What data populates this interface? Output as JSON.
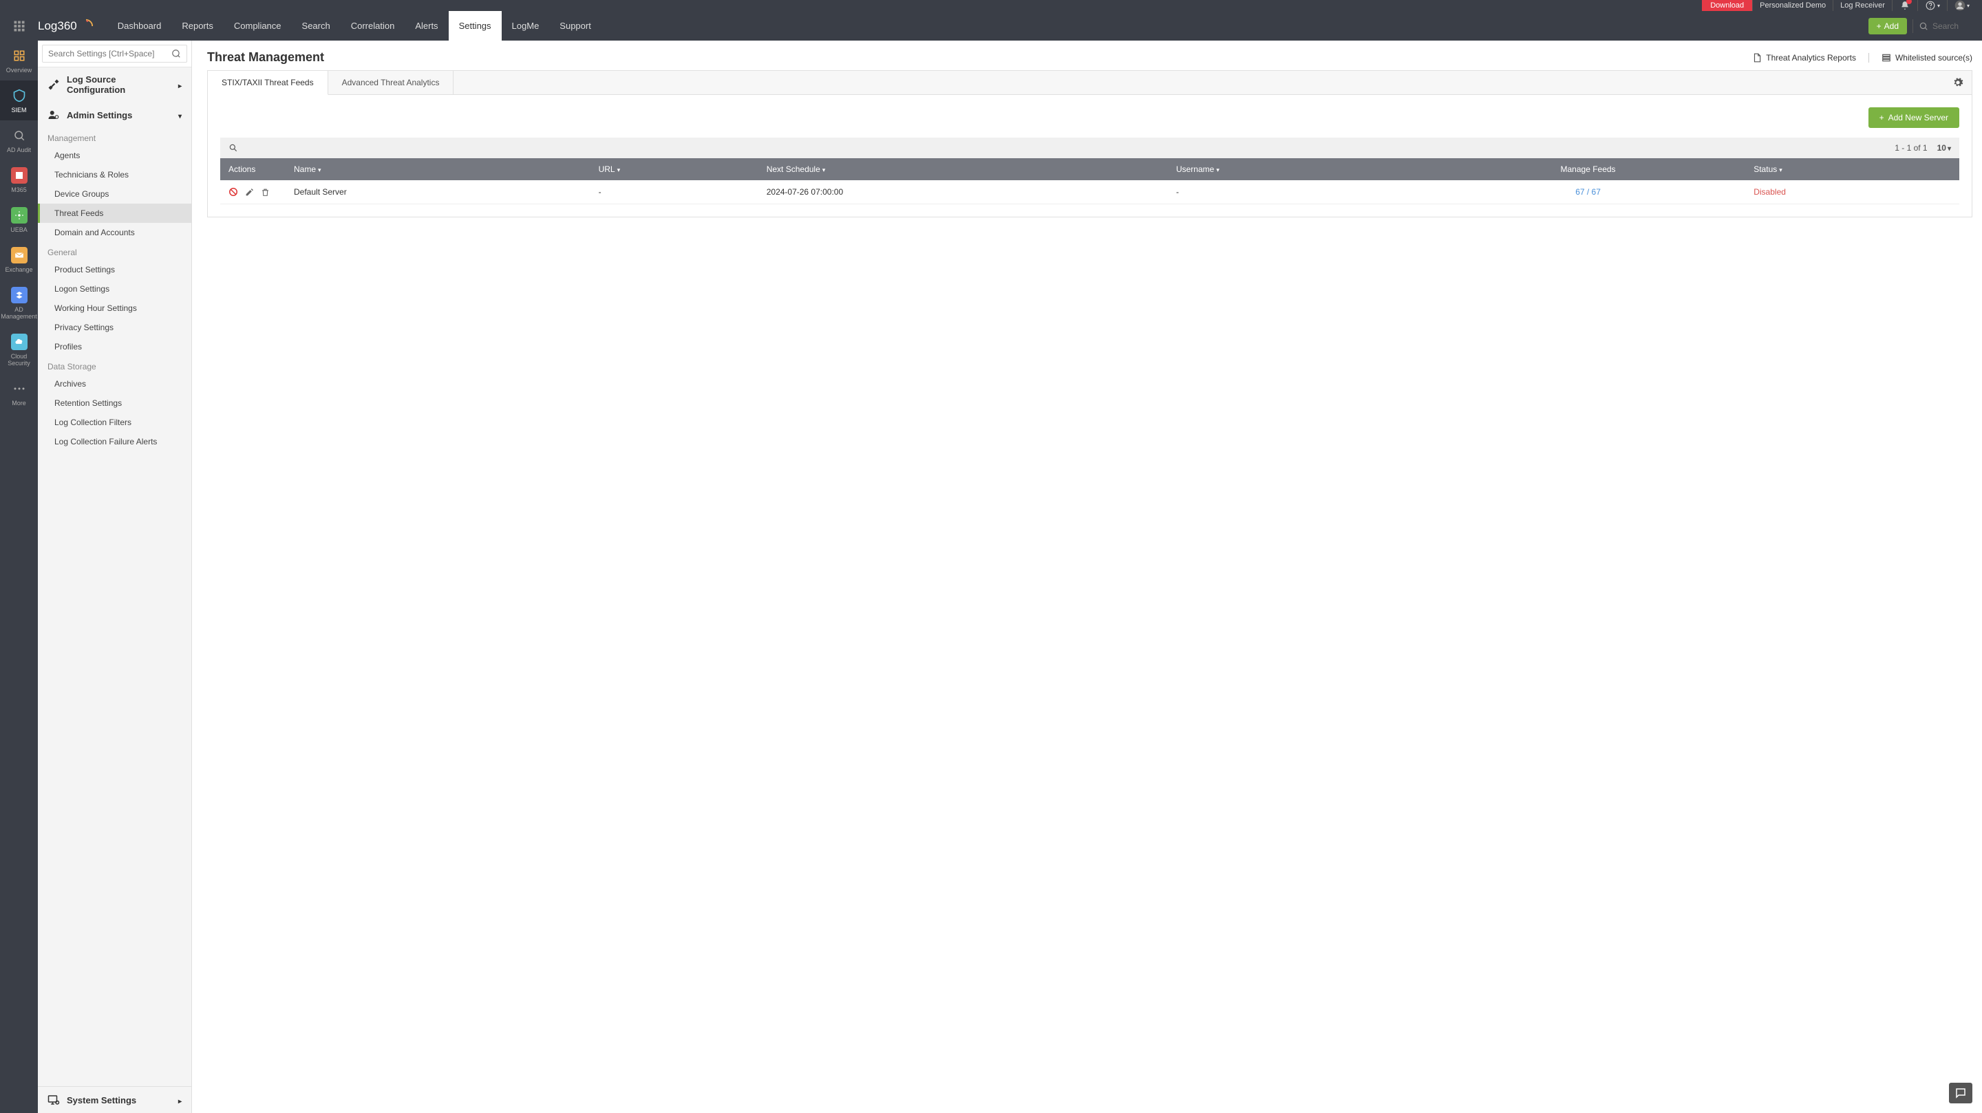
{
  "topbar": {
    "download": "Download",
    "demo": "Personalized Demo",
    "log_receiver": "Log Receiver"
  },
  "brand": "Log360",
  "nav": {
    "items": [
      "Dashboard",
      "Reports",
      "Compliance",
      "Search",
      "Correlation",
      "Alerts",
      "Settings",
      "LogMe",
      "Support"
    ],
    "active": "Settings",
    "add_label": "Add",
    "search_placeholder": "Search"
  },
  "leftrail": {
    "items": [
      {
        "label": "Overview",
        "color": "#f0ad4e"
      },
      {
        "label": "SIEM",
        "color": "#4aa3d4",
        "active": true
      },
      {
        "label": "AD Audit",
        "color": "#999"
      },
      {
        "label": "M365",
        "color": "#d9534f"
      },
      {
        "label": "UEBA",
        "color": "#5cb85c"
      },
      {
        "label": "Exchange",
        "color": "#f0ad4e"
      },
      {
        "label": "AD Management",
        "color": "#5b8def"
      },
      {
        "label": "Cloud Security",
        "color": "#5bc0de"
      },
      {
        "label": "More",
        "color": "#888"
      }
    ]
  },
  "sidebar": {
    "search_placeholder": "Search Settings [Ctrl+Space]",
    "sections": {
      "log_source": "Log Source Configuration",
      "admin": "Admin Settings",
      "system": "System Settings"
    },
    "groups": {
      "management": {
        "label": "Management",
        "items": [
          "Agents",
          "Technicians & Roles",
          "Device Groups",
          "Threat Feeds",
          "Domain and Accounts"
        ]
      },
      "general": {
        "label": "General",
        "items": [
          "Product Settings",
          "Logon Settings",
          "Working Hour Settings",
          "Privacy Settings",
          "Profiles"
        ]
      },
      "storage": {
        "label": "Data Storage",
        "items": [
          "Archives",
          "Retention Settings",
          "Log Collection Filters",
          "Log Collection Failure Alerts"
        ]
      }
    },
    "active_sub": "Threat Feeds"
  },
  "page": {
    "title": "Threat Management",
    "link_reports": "Threat Analytics Reports",
    "link_whitelist": "Whitelisted source(s)",
    "tabs": [
      "STIX/TAXII Threat Feeds",
      "Advanced Threat Analytics"
    ],
    "active_tab": "STIX/TAXII Threat Feeds",
    "add_server": "Add New Server",
    "pagination": "1 - 1 of 1",
    "page_size": "10"
  },
  "table": {
    "columns": {
      "actions": "Actions",
      "name": "Name",
      "url": "URL",
      "next": "Next Schedule",
      "user": "Username",
      "manage": "Manage Feeds",
      "status": "Status"
    },
    "rows": [
      {
        "name": "Default Server",
        "url": "-",
        "next": "2024-07-26 07:00:00",
        "user": "-",
        "manage": "67 / 67",
        "status": "Disabled"
      }
    ]
  }
}
